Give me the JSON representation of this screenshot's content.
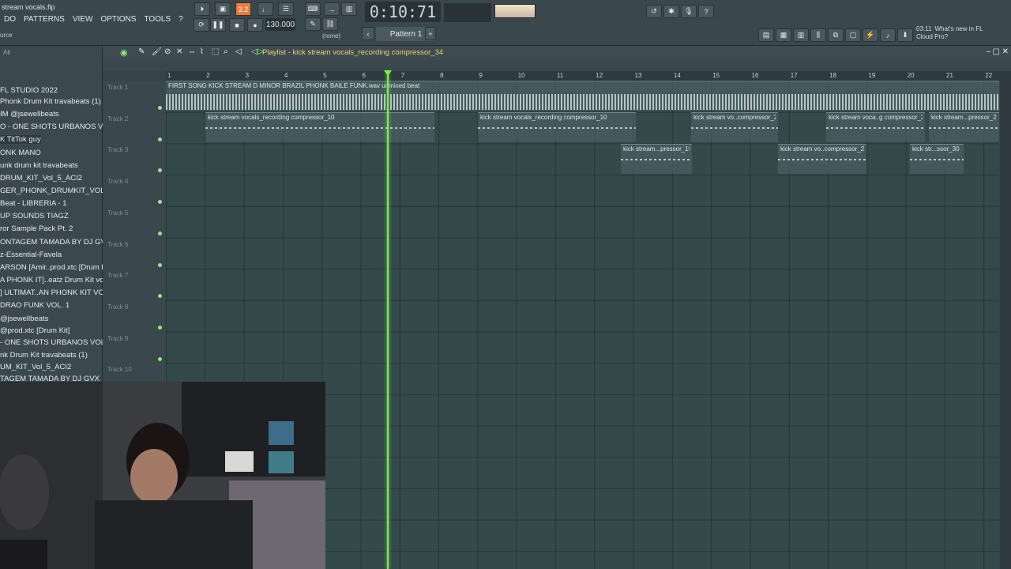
{
  "app": {
    "file_title": "stream vocals.flp",
    "menu": [
      "DO",
      "PATTERNS",
      "VIEW",
      "OPTIONS",
      "TOOLS",
      "?"
    ],
    "hint": "urce"
  },
  "transport": {
    "time": "0:10:71",
    "time_unit": "M:S:CS",
    "tempo": "130.000",
    "pattern": "Pattern 1",
    "snap": "(none)",
    "counter": "3.2"
  },
  "news": {
    "time": "03:11",
    "text_line1": "What's new in FL",
    "text_line2": "Cloud Pro?"
  },
  "browser": {
    "all_label": "All",
    "items": [
      "FL STUDIO 2022",
      "Phonk Drum Kit travabeats (1)",
      "IM @jsewellbeats",
      "O - ONE SHOTS URBANOS VOL. 2",
      "K TitTok guy",
      "ONK MANO",
      "unk drum kit travabeats",
      "DRUM_KIT_Vol_5_ACI2",
      "GER_PHONK_DRUMKIT_VOL_3",
      "Beat - LIBRERIA - 1",
      "UP SOUNDS TIAGZ",
      "ror Sample Pack Pt. 2",
      "ONTAGEM TAMADA BY DJ GVX",
      "z-Essential-Favela",
      "ARSON [Amir..prod.xtc [Drum Kit]",
      "A PHONK IT]..eatz Drum Kit vol 1",
      "] ULTIMAT..AN PHONK KIT VOL. 3",
      "DRAO FUNK VOL. 1",
      "@jsewellbeats",
      "@prod.xtc [Drum Kit]",
      "- ONE SHOTS URBANOS VOL. 2",
      "nk Drum Kit travabeats (1)",
      "UM_KIT_Vol_5_ACI2",
      "TAGEM TAMADA BY DJ GVX"
    ]
  },
  "playlist": {
    "title": "Playlist - kick stream vocals_recording compressor_34",
    "ruler": [
      "1",
      "2",
      "3",
      "4",
      "5",
      "6",
      "7",
      "8",
      "9",
      "10",
      "11",
      "12",
      "13",
      "14",
      "15",
      "16",
      "17",
      "18",
      "19",
      "20",
      "21",
      "22"
    ],
    "tracks": [
      "Track 1",
      "Track 2",
      "Track 3",
      "Track 4",
      "Track 5",
      "Track 6",
      "Track 7",
      "Track 8",
      "Track 9",
      "Track 10"
    ],
    "clips": [
      {
        "label": "FIRST SONG KICK STREAM D MINOR BRAZIL PHONK BAILE FUNK.wav unmixed beat"
      },
      {
        "label": "kick stream vocals_recording compressor_10"
      },
      {
        "label": "kick stream vocals_recording compressor_10"
      },
      {
        "label": "kick stream vo..compressor_21"
      },
      {
        "label": "kick stream voca..g compressor_28"
      },
      {
        "label": "kick stream...pressor_29"
      },
      {
        "label": "kick stream...pressor_19"
      },
      {
        "label": "kick stream vo..compressor_23"
      },
      {
        "label": "kick str...ssor_30"
      }
    ]
  },
  "colors": {
    "playhead": "#7cf04a",
    "title": "#f0d070",
    "accent": "#f07a3a"
  }
}
